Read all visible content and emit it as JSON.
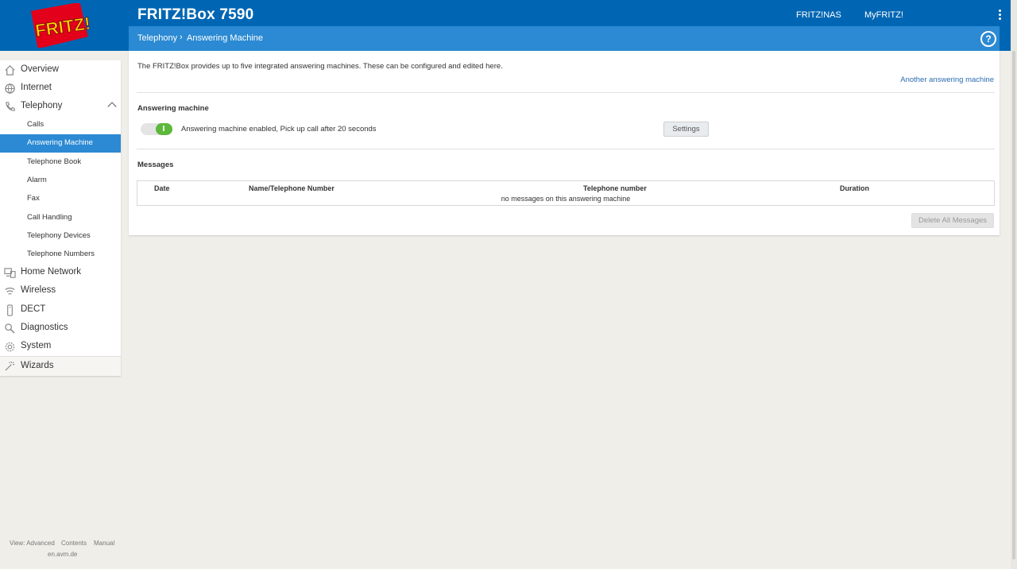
{
  "header": {
    "logo_text": "FRITZ!",
    "app_title": "FRITZ!Box 7590",
    "links": [
      "FRITZ!NAS",
      "MyFRITZ!"
    ],
    "breadcrumb": [
      "Telephony",
      "Answering Machine"
    ],
    "help_symbol": "?"
  },
  "sidebar": {
    "items": [
      {
        "label": "Overview",
        "icon": "home-icon"
      },
      {
        "label": "Internet",
        "icon": "globe-icon"
      },
      {
        "label": "Telephony",
        "icon": "phone-icon",
        "expanded": true
      },
      {
        "label": "Home Network",
        "icon": "network-icon"
      },
      {
        "label": "Wireless",
        "icon": "wifi-icon"
      },
      {
        "label": "DECT",
        "icon": "dect-handset-icon"
      },
      {
        "label": "Diagnostics",
        "icon": "diagnostics-icon"
      },
      {
        "label": "System",
        "icon": "system-gear-icon"
      },
      {
        "label": "Wizards",
        "icon": "wizard-icon"
      }
    ],
    "telephony_sub": [
      {
        "label": "Calls"
      },
      {
        "label": "Answering Machine",
        "active": true
      },
      {
        "label": "Telephone Book"
      },
      {
        "label": "Alarm"
      },
      {
        "label": "Fax"
      },
      {
        "label": "Call Handling"
      },
      {
        "label": "Telephony Devices"
      },
      {
        "label": "Telephone Numbers"
      }
    ]
  },
  "footer": {
    "links": [
      "View: Advanced",
      "Contents",
      "Manual"
    ],
    "domain": "en.avm.de"
  },
  "main": {
    "intro": "The FRITZ!Box provides up to five integrated answering machines. These can be configured and edited here.",
    "another_link": "Another answering machine",
    "answering_machine": {
      "title": "Answering machine",
      "toggle_on": true,
      "status": "Answering machine enabled, Pick up call after 20 seconds",
      "settings_label": "Settings"
    },
    "messages": {
      "title": "Messages",
      "columns": [
        "Date",
        "Name/Telephone Number",
        "Telephone number",
        "Duration"
      ],
      "empty_text": "no messages on this answering machine",
      "delete_all_label": "Delete All Messages"
    }
  },
  "colors": {
    "brand_blue": "#0066b3",
    "accent_blue": "#2b8ad3",
    "toggle_green": "#5cb83a",
    "logo_red": "#e2001a"
  }
}
